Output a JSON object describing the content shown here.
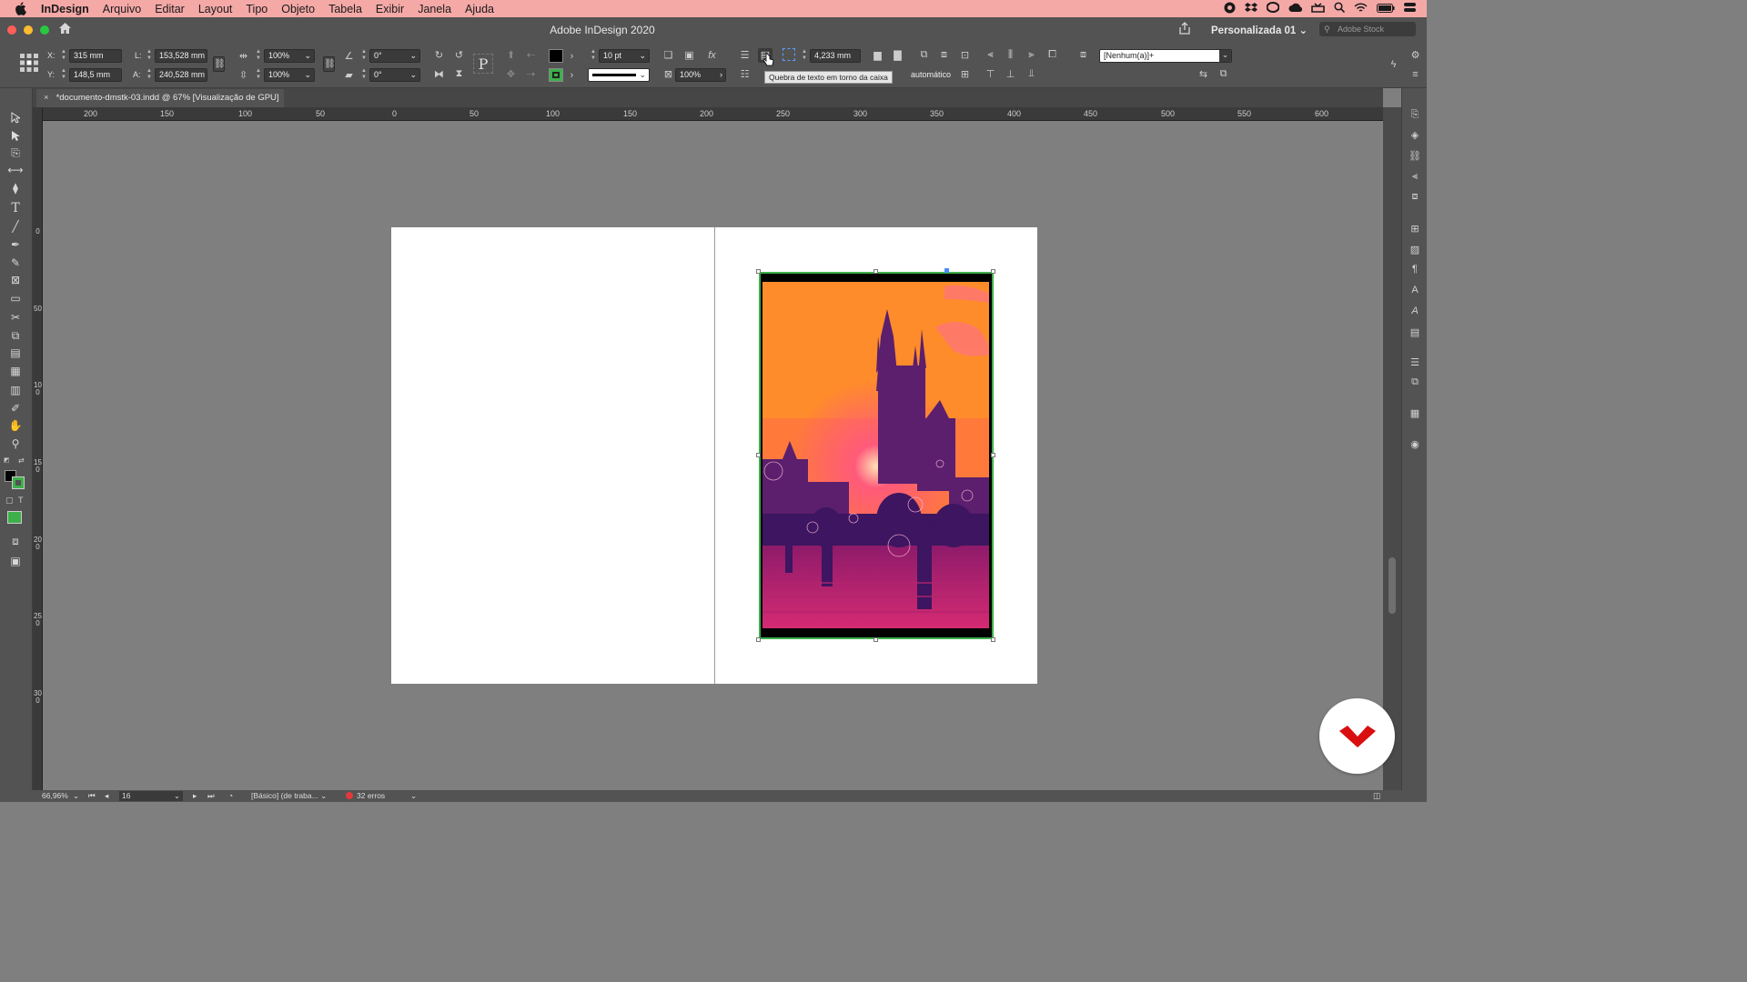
{
  "menubar": {
    "app_name": "InDesign",
    "items": [
      "Arquivo",
      "Editar",
      "Layout",
      "Tipo",
      "Objeto",
      "Tabela",
      "Exibir",
      "Janela",
      "Ajuda"
    ]
  },
  "titlebar": {
    "title": "Adobe InDesign 2020",
    "workspace": "Personalizada 01",
    "stock_placeholder": "Adobe Stock"
  },
  "control": {
    "x_label": "X:",
    "x_value": "315 mm",
    "y_label": "Y:",
    "y_value": "148,5 mm",
    "w_label": "L:",
    "w_value": "153,528 mm",
    "h_label": "A:",
    "h_value": "240,528 mm",
    "scale_x": "100%",
    "scale_y": "100%",
    "rotate": "0°",
    "shear": "0°",
    "stroke_weight": "10 pt",
    "opacity": "100%",
    "offset": "4,233 mm",
    "auto_label": "automático",
    "object_style": "[Nenhum(a)]+"
  },
  "tooltip": "Quebra de texto em torno da caixa",
  "document_tab": {
    "close": "×",
    "title": "*documento-dmstk-03.indd @ 67% [Visualização de GPU]"
  },
  "ruler_h": [
    "200",
    "150",
    "100",
    "50",
    "0",
    "50",
    "100",
    "150",
    "200",
    "250",
    "300",
    "350",
    "400",
    "450",
    "500",
    "550",
    "600"
  ],
  "ruler_v": [
    "0",
    "50",
    "100",
    "150",
    "200",
    "250",
    "300"
  ],
  "status": {
    "zoom": "66,96%",
    "page": "16",
    "preflight_profile": "[Básico] (de traba...",
    "errors": "32 erros"
  },
  "colors": {
    "menubar_bg": "#f4a9a7",
    "panel_bg": "#535353",
    "pasteboard": "#7f7f7f",
    "frame_stroke": "#3db04a",
    "error_dot": "#e03a3a",
    "logo_red": "#d90f0f"
  }
}
